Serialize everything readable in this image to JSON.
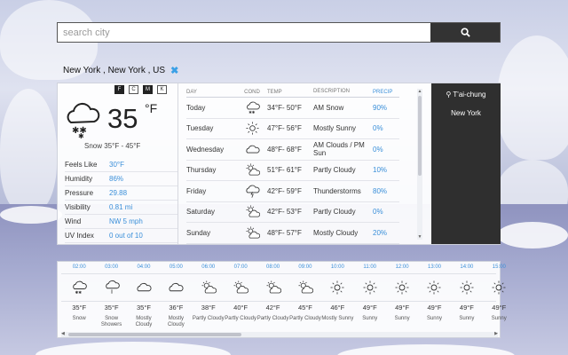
{
  "search": {
    "placeholder": "search city",
    "button_icon": "search-icon"
  },
  "location": {
    "label": "New York , New York , US",
    "close_icon": "close-icon",
    "accent": "#3aa0e6"
  },
  "units": [
    {
      "label": "F",
      "active": true
    },
    {
      "label": "C",
      "active": false
    },
    {
      "label": "M",
      "active": true
    },
    {
      "label": "K",
      "active": false
    }
  ],
  "current": {
    "icon": "snow-cloud-icon",
    "temp": "35",
    "unit": "°F",
    "summary": "Snow 35°F - 45°F",
    "details": [
      {
        "label": "Feels Like",
        "value": "30°F"
      },
      {
        "label": "Humidity",
        "value": "86%"
      },
      {
        "label": "Pressure",
        "value": "29.88"
      },
      {
        "label": "Visibility",
        "value": "0.81 mi"
      },
      {
        "label": "Wind",
        "value": "NW 5 mph"
      },
      {
        "label": "UV Index",
        "value": "0 out of 10"
      }
    ]
  },
  "daily": {
    "headers": {
      "day": "DAY",
      "cond": "COND",
      "temp": "TEMP",
      "desc": "DESCRIPTION",
      "precip": "PRECIP"
    },
    "rows": [
      {
        "day": "Today",
        "icon": "snow-cloud-icon",
        "temp": "34°F- 50°F",
        "desc": "AM Snow",
        "precip": "90%"
      },
      {
        "day": "Tuesday",
        "icon": "sun-icon",
        "temp": "47°F- 56°F",
        "desc": "Mostly Sunny",
        "precip": "0%"
      },
      {
        "day": "Wednesday",
        "icon": "cloud-icon",
        "temp": "48°F- 68°F",
        "desc": "AM Clouds / PM Sun",
        "precip": "0%"
      },
      {
        "day": "Thursday",
        "icon": "partly-cloudy-icon",
        "temp": "51°F- 61°F",
        "desc": "Partly Cloudy",
        "precip": "10%"
      },
      {
        "day": "Friday",
        "icon": "thunderstorm-icon",
        "temp": "42°F- 59°F",
        "desc": "Thunderstorms",
        "precip": "80%"
      },
      {
        "day": "Saturday",
        "icon": "partly-cloudy-icon",
        "temp": "42°F- 53°F",
        "desc": "Partly Cloudy",
        "precip": "0%"
      },
      {
        "day": "Sunday",
        "icon": "partly-cloudy-icon",
        "temp": "48°F- 57°F",
        "desc": "Mostly Cloudy",
        "precip": "20%"
      }
    ]
  },
  "cities": [
    {
      "name": "T'ai-chung",
      "pin_icon": "map-pin-icon"
    },
    {
      "name": "New York"
    }
  ],
  "hourly": [
    {
      "time": "02:00",
      "icon": "snow-cloud-icon",
      "temp": "35°F",
      "desc": "Snow"
    },
    {
      "time": "03:00",
      "icon": "snow-showers-icon",
      "temp": "35°F",
      "desc": "Snow Showers"
    },
    {
      "time": "04:00",
      "icon": "cloud-icon",
      "temp": "35°F",
      "desc": "Mostly Cloudy"
    },
    {
      "time": "05:00",
      "icon": "cloud-icon",
      "temp": "36°F",
      "desc": "Mostly Cloudy"
    },
    {
      "time": "06:00",
      "icon": "partly-cloudy-icon",
      "temp": "38°F",
      "desc": "Partly Cloudy"
    },
    {
      "time": "07:00",
      "icon": "partly-cloudy-icon",
      "temp": "40°F",
      "desc": "Partly Cloudy"
    },
    {
      "time": "08:00",
      "icon": "partly-cloudy-icon",
      "temp": "42°F",
      "desc": "Partly Cloudy"
    },
    {
      "time": "09:00",
      "icon": "partly-cloudy-icon",
      "temp": "45°F",
      "desc": "Partly Cloudy"
    },
    {
      "time": "10:00",
      "icon": "sun-icon",
      "temp": "46°F",
      "desc": "Mostly Sunny"
    },
    {
      "time": "11:00",
      "icon": "sun-icon",
      "temp": "49°F",
      "desc": "Sunny"
    },
    {
      "time": "12:00",
      "icon": "sun-icon",
      "temp": "49°F",
      "desc": "Sunny"
    },
    {
      "time": "13:00",
      "icon": "sun-icon",
      "temp": "49°F",
      "desc": "Sunny"
    },
    {
      "time": "14:00",
      "icon": "sun-icon",
      "temp": "49°F",
      "desc": "Sunny"
    },
    {
      "time": "15:00",
      "icon": "sun-icon",
      "temp": "49°F",
      "desc": "Sunny"
    }
  ],
  "colors": {
    "accent": "#3a8fd9",
    "sidebar": "#2f2f2f",
    "search_button": "#333333"
  }
}
